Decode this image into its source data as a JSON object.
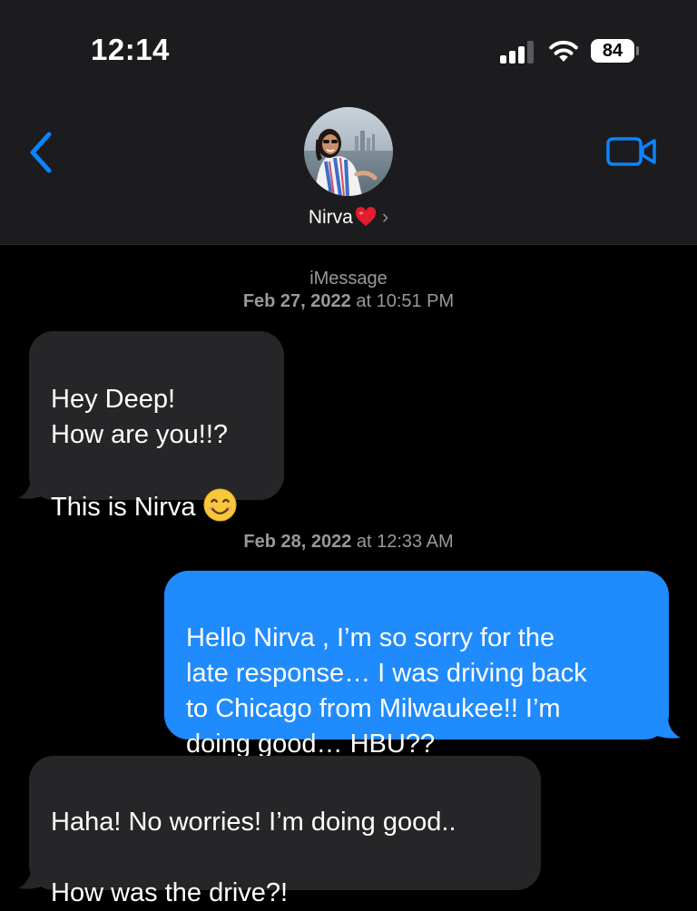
{
  "status_bar": {
    "time": "12:14",
    "battery_level": "84",
    "signal_bars_active": 3,
    "signal_bars_total": 4
  },
  "header": {
    "back_icon": "chevron-left-icon",
    "video_icon": "video-camera-icon",
    "contact_name": "Nirva",
    "contact_emoji": "red-heart-emoji",
    "disclosure_icon": "chevron-right-icon",
    "disclosure_glyph": "›"
  },
  "thread": {
    "service_label": "iMessage",
    "timestamp_1": {
      "date": "Feb 27, 2022",
      "time": "at 10:51 PM"
    },
    "timestamp_2": {
      "date": "Feb 28, 2022",
      "time": "at 12:33 AM"
    },
    "messages": [
      {
        "direction": "incoming",
        "text": "Hey Deep!\nHow are you!!?\n\nThis is Nirva",
        "emoji": "smiling-face-emoji"
      },
      {
        "direction": "outgoing",
        "text": "Hello Nirva , I’m so sorry for the\nlate response… I was driving back\nto Chicago from Milwaukee!! I’m\ndoing good… HBU??"
      },
      {
        "direction": "incoming",
        "text": "Haha! No worries! I’m doing good..\n\nHow was the drive?!"
      }
    ]
  },
  "colors": {
    "accent": "#0a84ff",
    "outgoing_bubble": "#1f8bfc",
    "incoming_bubble": "#262628",
    "header_bg": "#1c1c1e",
    "meta_text": "#98989d"
  }
}
